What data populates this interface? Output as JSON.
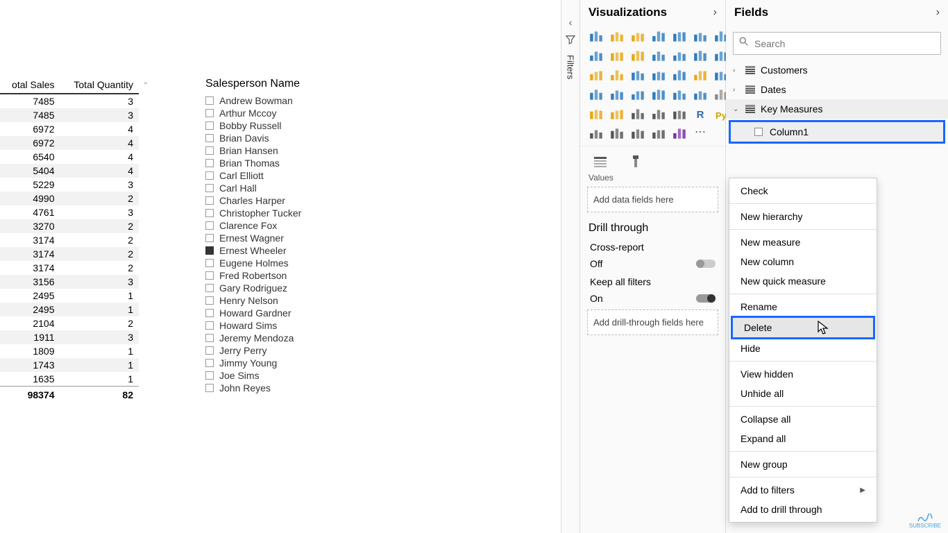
{
  "table": {
    "col1_header": "otal Sales",
    "col2_header": "Total Quantity",
    "rows": [
      {
        "sales": "7485",
        "qty": "3"
      },
      {
        "sales": "7485",
        "qty": "3"
      },
      {
        "sales": "6972",
        "qty": "4"
      },
      {
        "sales": "6972",
        "qty": "4"
      },
      {
        "sales": "6540",
        "qty": "4"
      },
      {
        "sales": "5404",
        "qty": "4"
      },
      {
        "sales": "5229",
        "qty": "3"
      },
      {
        "sales": "4990",
        "qty": "2"
      },
      {
        "sales": "4761",
        "qty": "3"
      },
      {
        "sales": "3270",
        "qty": "2"
      },
      {
        "sales": "3174",
        "qty": "2"
      },
      {
        "sales": "3174",
        "qty": "2"
      },
      {
        "sales": "3174",
        "qty": "2"
      },
      {
        "sales": "3156",
        "qty": "3"
      },
      {
        "sales": "2495",
        "qty": "1"
      },
      {
        "sales": "2495",
        "qty": "1"
      },
      {
        "sales": "2104",
        "qty": "2"
      },
      {
        "sales": "1911",
        "qty": "3"
      },
      {
        "sales": "1809",
        "qty": "1"
      },
      {
        "sales": "1743",
        "qty": "1"
      },
      {
        "sales": "1635",
        "qty": "1"
      }
    ],
    "total_sales": "98374",
    "total_qty": "82"
  },
  "slicer": {
    "title": "Salesperson Name",
    "items": [
      {
        "name": "Andrew Bowman",
        "checked": false
      },
      {
        "name": "Arthur Mccoy",
        "checked": false
      },
      {
        "name": "Bobby Russell",
        "checked": false
      },
      {
        "name": "Brian Davis",
        "checked": false
      },
      {
        "name": "Brian Hansen",
        "checked": false
      },
      {
        "name": "Brian Thomas",
        "checked": false
      },
      {
        "name": "Carl Elliott",
        "checked": false
      },
      {
        "name": "Carl Hall",
        "checked": false
      },
      {
        "name": "Charles Harper",
        "checked": false
      },
      {
        "name": "Christopher Tucker",
        "checked": false
      },
      {
        "name": "Clarence Fox",
        "checked": false
      },
      {
        "name": "Ernest Wagner",
        "checked": false
      },
      {
        "name": "Ernest Wheeler",
        "checked": true
      },
      {
        "name": "Eugene Holmes",
        "checked": false
      },
      {
        "name": "Fred Robertson",
        "checked": false
      },
      {
        "name": "Gary Rodriguez",
        "checked": false
      },
      {
        "name": "Henry Nelson",
        "checked": false
      },
      {
        "name": "Howard Gardner",
        "checked": false
      },
      {
        "name": "Howard Sims",
        "checked": false
      },
      {
        "name": "Jeremy Mendoza",
        "checked": false
      },
      {
        "name": "Jerry Perry",
        "checked": false
      },
      {
        "name": "Jimmy Young",
        "checked": false
      },
      {
        "name": "Joe Sims",
        "checked": false
      },
      {
        "name": "John Reyes",
        "checked": false
      }
    ]
  },
  "filters_label": "Filters",
  "viz": {
    "title": "Visualizations",
    "values_label": "Values",
    "values_well": "Add data fields here",
    "drill_header": "Drill through",
    "cross_report_label": "Cross-report",
    "cross_report_state": "Off",
    "keep_filters_label": "Keep all filters",
    "keep_filters_state": "On",
    "drill_well": "Add drill-through fields here"
  },
  "fields": {
    "title": "Fields",
    "search_placeholder": "Search",
    "tables": [
      {
        "name": "Customers",
        "expanded": false
      },
      {
        "name": "Dates",
        "expanded": false
      },
      {
        "name": "Key Measures",
        "expanded": true
      }
    ],
    "column_name": "Column1"
  },
  "context_menu": {
    "items": [
      {
        "label": "Check",
        "group": 0
      },
      {
        "label": "New hierarchy",
        "group": 1
      },
      {
        "label": "New measure",
        "group": 2
      },
      {
        "label": "New column",
        "group": 2
      },
      {
        "label": "New quick measure",
        "group": 2
      },
      {
        "label": "Rename",
        "group": 3
      },
      {
        "label": "Delete",
        "group": 3,
        "highlighted": true
      },
      {
        "label": "Hide",
        "group": 3
      },
      {
        "label": "View hidden",
        "group": 4
      },
      {
        "label": "Unhide all",
        "group": 4
      },
      {
        "label": "Collapse all",
        "group": 5
      },
      {
        "label": "Expand all",
        "group": 5
      },
      {
        "label": "New group",
        "group": 6
      },
      {
        "label": "Add to filters",
        "group": 7,
        "submenu": true
      },
      {
        "label": "Add to drill through",
        "group": 7
      }
    ]
  },
  "subscribe_label": "SUBSCRIBE"
}
